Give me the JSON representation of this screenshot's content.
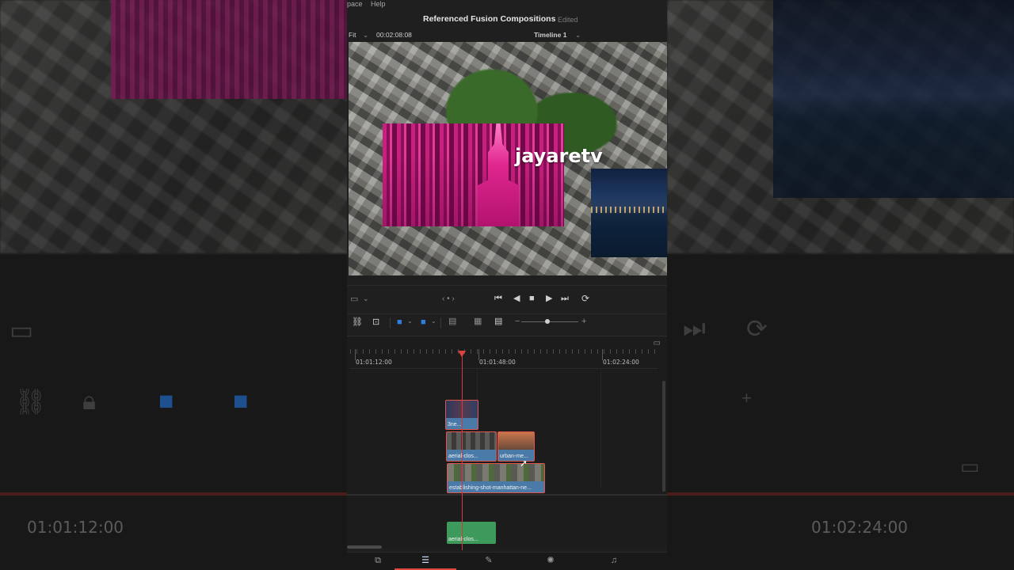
{
  "menu": {
    "item1": "pace",
    "item2": "Help"
  },
  "project": {
    "title": "Referenced Fusion Compositions",
    "status": "Edited"
  },
  "viewer": {
    "zoom": "Fit",
    "timecode": "00:02:08:08",
    "timeline_name": "Timeline 1",
    "overlay_text": "jayaretv"
  },
  "timeline": {
    "ruler_labels": [
      "01:01:12:00",
      "01:01:48:00",
      "01:02:24:00"
    ],
    "clips": {
      "v4": "3ne...",
      "v3a": "aerial-clos...",
      "v3b": "urban-me...",
      "v2": "establishing-shot-manhattan-ne...",
      "a1": "aerial-clos..."
    }
  },
  "background": {
    "timecode_left": "01:01:12:00",
    "timecode_right": "01:02:24:00"
  },
  "colors": {
    "playhead": "#e04040",
    "clip_selected_border": "#e2554d",
    "video_clip": "#4a7aa8",
    "audio_clip": "#3e9a5c"
  }
}
